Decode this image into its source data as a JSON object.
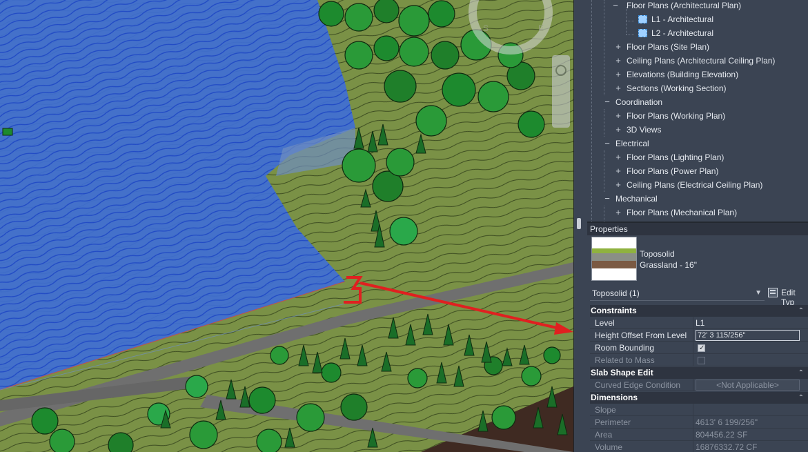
{
  "project_browser": {
    "items": [
      {
        "label": "Floor Plans (Architectural Plan)",
        "toggle": "−"
      },
      {
        "label": "L1 - Architectural",
        "toggle": ""
      },
      {
        "label": "L2 - Architectural",
        "toggle": ""
      },
      {
        "label": "Floor Plans (Site Plan)",
        "toggle": "+"
      },
      {
        "label": "Ceiling Plans (Architectural Ceiling Plan)",
        "toggle": "+"
      },
      {
        "label": "Elevations (Building Elevation)",
        "toggle": "+"
      },
      {
        "label": "Sections (Working Section)",
        "toggle": "+"
      },
      {
        "label": "Coordination",
        "toggle": "−"
      },
      {
        "label": "Floor Plans (Working Plan)",
        "toggle": "+"
      },
      {
        "label": "3D Views",
        "toggle": "+"
      },
      {
        "label": "Electrical",
        "toggle": "−"
      },
      {
        "label": "Floor Plans (Lighting Plan)",
        "toggle": "+"
      },
      {
        "label": "Floor Plans (Power Plan)",
        "toggle": "+"
      },
      {
        "label": "Ceiling Plans (Electrical Ceiling Plan)",
        "toggle": "+"
      },
      {
        "label": "Mechanical",
        "toggle": "−"
      },
      {
        "label": "Floor Plans (Mechanical Plan)",
        "toggle": "+"
      }
    ]
  },
  "properties": {
    "header": "Properties",
    "type_name": "Toposolid",
    "type_subname": "Grassland - 16\"",
    "instance_selector": "Toposolid (1)",
    "edit_type": "Edit Typ",
    "groups": {
      "constraints": "Constraints",
      "slab_shape_edit": "Slab Shape Edit",
      "dimensions": "Dimensions"
    },
    "rows": {
      "level": {
        "name": "Level",
        "value": "L1"
      },
      "height_offset": {
        "name": "Height Offset From Level",
        "value": "72'  3 115/256\""
      },
      "room_bounding": {
        "name": "Room Bounding",
        "checked": true
      },
      "related_to_mass": {
        "name": "Related to Mass",
        "checked": false
      },
      "curved_edge": {
        "name": "Curved Edge Condition",
        "value": "<Not Applicable>"
      },
      "slope": {
        "name": "Slope",
        "value": ""
      },
      "perimeter": {
        "name": "Perimeter",
        "value": "4613'  6 199/256\""
      },
      "area": {
        "name": "Area",
        "value": "804456.22 SF"
      },
      "volume": {
        "name": "Volume",
        "value": "16876332.72 CF"
      }
    }
  },
  "colors": {
    "terrain": "#7a9146",
    "selection_blue": "#3f6fd6",
    "arrow_red": "#e02020",
    "panel_bg": "#3b4453",
    "header_bg": "#2e3440"
  }
}
